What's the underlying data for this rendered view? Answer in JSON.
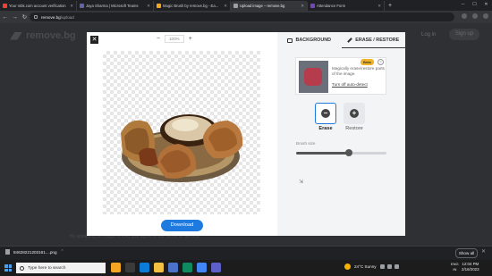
{
  "browser": {
    "tabs": [
      {
        "label": "Your mbk.com account verification",
        "icon": "gmail-icon",
        "color": "#ea4335"
      },
      {
        "label": "Jaya Sharma | Microsoft Teams",
        "icon": "teams-icon",
        "color": "#6264a7"
      },
      {
        "label": "Magic Brush by remove.bg - Ea...",
        "icon": "magic-brush-icon",
        "color": "#f5a623"
      },
      {
        "label": "Upload image – remove.bg",
        "icon": "removebg-icon",
        "color": "#9aa0a6"
      },
      {
        "label": "Attendance Form",
        "icon": "form-icon",
        "color": "#7248b9"
      }
    ],
    "active_tab": 3,
    "new_tab": "+",
    "url_host": "remove.bg",
    "url_path": "/upload"
  },
  "page": {
    "logo_text": "remove.bg",
    "login": "Log in",
    "signup": "Sign up",
    "footer_text": "By uploading an image or URL you agree to our Terms of Service."
  },
  "editor": {
    "zoom_out": "−",
    "zoom_value": "100%",
    "zoom_in": "+",
    "close": "✕",
    "download": "Download",
    "tabs": {
      "background": "BACKGROUND",
      "erase_restore": "ERASE / RESTORE"
    },
    "magic": {
      "beta": "Beta",
      "help": "?",
      "description": "Magically erase/restore parts of the image.",
      "autodetect": "Turn off auto-detect"
    },
    "erase_label": "Erase",
    "restore_label": "Restore",
    "brush_size_label": "Brush size",
    "brush_size_value": 0.58,
    "accent": "#1f7ae0"
  },
  "downloads": {
    "file": "84628221203161....png",
    "show_all": "Show all"
  },
  "taskbar": {
    "search_placeholder": "Type here to search",
    "weather": "24°C  Sunny",
    "lang_line1": "ENG",
    "lang_line2": "IN",
    "time": "12:04 PM",
    "date": "2/16/2023"
  }
}
